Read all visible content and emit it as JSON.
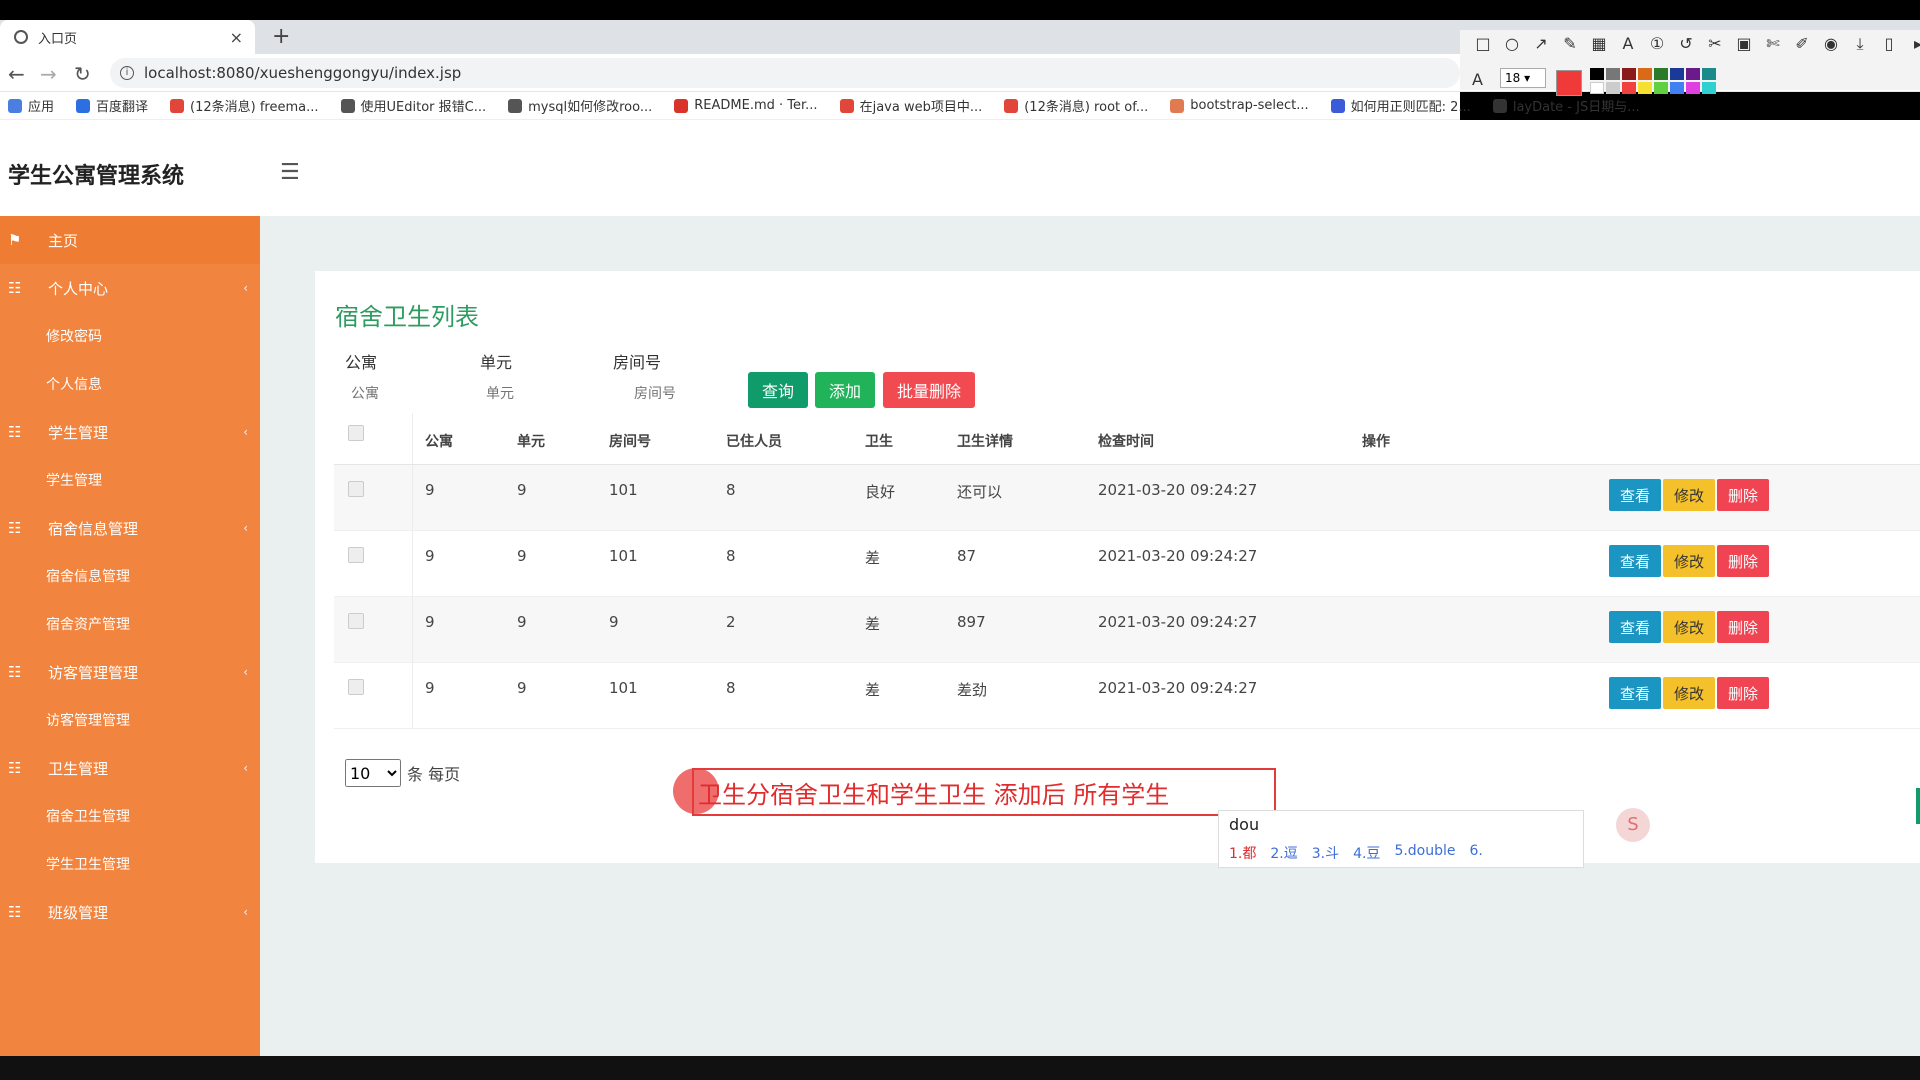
{
  "browser": {
    "tab_title": "入口页",
    "tab_close": "×",
    "new_tab": "+",
    "url": "localhost:8080/xueshenggongyu/index.jsp",
    "bookmarks": [
      {
        "label": "应用",
        "color": "#4a7ee0"
      },
      {
        "label": "百度翻译",
        "color": "#2b6fe0"
      },
      {
        "label": "(12条消息) freema...",
        "color": "#e0463a"
      },
      {
        "label": "使用UEditor 报错C...",
        "color": "#555555"
      },
      {
        "label": "mysql如何修改roo...",
        "color": "#555555"
      },
      {
        "label": "README.md · Ter...",
        "color": "#d9342b"
      },
      {
        "label": "在java web项目中...",
        "color": "#e0463a"
      },
      {
        "label": "(12条消息) root of...",
        "color": "#e0463a"
      },
      {
        "label": "bootstrap-select...",
        "color": "#e07a50"
      },
      {
        "label": "如何用正则匹配: 2...",
        "color": "#3b5bd8"
      },
      {
        "label": "layDate - JS日期与...",
        "color": "#333333"
      }
    ],
    "ext_font_size": "18"
  },
  "app": {
    "title": "学生公寓管理系统"
  },
  "sidebar": {
    "items": [
      {
        "label": "主页",
        "type": "home"
      },
      {
        "label": "个人中心",
        "type": "group"
      },
      {
        "label": "修改密码",
        "type": "child"
      },
      {
        "label": "个人信息",
        "type": "child"
      },
      {
        "label": "学生管理",
        "type": "group"
      },
      {
        "label": "学生管理",
        "type": "child"
      },
      {
        "label": "宿舍信息管理",
        "type": "group"
      },
      {
        "label": "宿舍信息管理",
        "type": "child"
      },
      {
        "label": "宿舍资产管理",
        "type": "child"
      },
      {
        "label": "访客管理管理",
        "type": "group"
      },
      {
        "label": "访客管理管理",
        "type": "child"
      },
      {
        "label": "卫生管理",
        "type": "group"
      },
      {
        "label": "宿舍卫生管理",
        "type": "child"
      },
      {
        "label": "学生卫生管理",
        "type": "child"
      },
      {
        "label": "班级管理",
        "type": "group"
      }
    ]
  },
  "main": {
    "title": "宿舍卫生列表",
    "filters": {
      "apartment_label": "公寓",
      "apartment_placeholder": "公寓",
      "unit_label": "单元",
      "unit_placeholder": "单元",
      "room_label": "房间号",
      "room_placeholder": "房间号"
    },
    "buttons": {
      "query": "查询",
      "add": "添加",
      "bulk_delete": "批量删除"
    },
    "table": {
      "headers": [
        "公寓",
        "单元",
        "房间号",
        "已住人员",
        "卫生",
        "卫生详情",
        "检查时间",
        "操作"
      ],
      "rows": [
        [
          "9",
          "9",
          "101",
          "8",
          "良好",
          "还可以",
          "2021-03-20 09:24:27"
        ],
        [
          "9",
          "9",
          "101",
          "8",
          "差",
          "87",
          "2021-03-20 09:24:27"
        ],
        [
          "9",
          "9",
          "9",
          "2",
          "差",
          "897",
          "2021-03-20 09:24:27"
        ],
        [
          "9",
          "9",
          "101",
          "8",
          "差",
          "差劲",
          "2021-03-20 09:24:27"
        ]
      ],
      "actions": {
        "view": "查看",
        "edit": "修改",
        "delete": "删除"
      }
    },
    "pager": {
      "page_size": "10",
      "suffix": "条 每页"
    }
  },
  "annotation": {
    "text": "卫生分宿舍卫生和学生卫生   添加后 所有学生"
  },
  "ime": {
    "composition": "dou",
    "candidates": [
      "1.都",
      "2.逗",
      "3.斗",
      "4.豆",
      "5.double",
      "6."
    ]
  },
  "colors": {
    "sidebar": "#f1843e",
    "title_green": "#2e9c60",
    "query": "#0f9b6a",
    "add": "#20b35a",
    "danger": "#f14a51",
    "view": "#1b96c2",
    "edit": "#f5c12a"
  }
}
